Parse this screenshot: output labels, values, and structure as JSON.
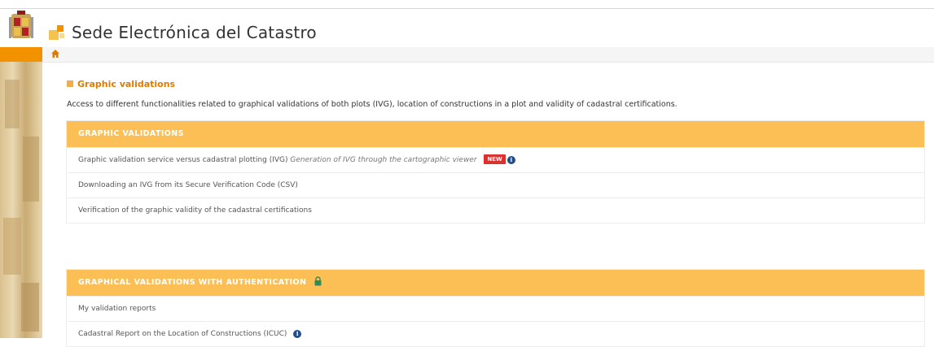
{
  "header": {
    "site_title": "Sede Electrónica del Catastro",
    "crest_icon": "spain-coat-of-arms-icon",
    "logo_icon": "catastro-logo-icon"
  },
  "breadcrumb": {
    "home_icon": "home-icon"
  },
  "main": {
    "title": "Graphic validations",
    "description": "Access to different functionalities related to graphical validations of both plots (IVG), location of constructions in a plot and validity of cadastral certifications.",
    "panels": [
      {
        "heading": "GRAPHIC VALIDATIONS",
        "items": [
          {
            "label": "Graphic validation service versus cadastral plotting (IVG)",
            "italic_link": "Generation of IVG through the cartographic viewer",
            "badge": "NEW",
            "info": "i"
          },
          {
            "label": "Downloading an IVG from its Secure Verification Code (CSV)"
          },
          {
            "label": "Verification of the graphic validity of the cadastral certifications"
          }
        ]
      },
      {
        "heading": "GRAPHICAL VALIDATIONS WITH AUTHENTICATION",
        "heading_icon": "lock-icon",
        "items": [
          {
            "label": "My validation reports"
          },
          {
            "label": "Cadastral Report on the Location of Constructions (ICUC)",
            "info": "i"
          }
        ]
      }
    ]
  },
  "colors": {
    "accent_orange": "#f39200",
    "title_orange": "#e07b00",
    "panel_header": "#fbbf56",
    "badge_red": "#d9322f",
    "info_blue": "#1f4e8a",
    "lock_green": "#2e8b57"
  }
}
